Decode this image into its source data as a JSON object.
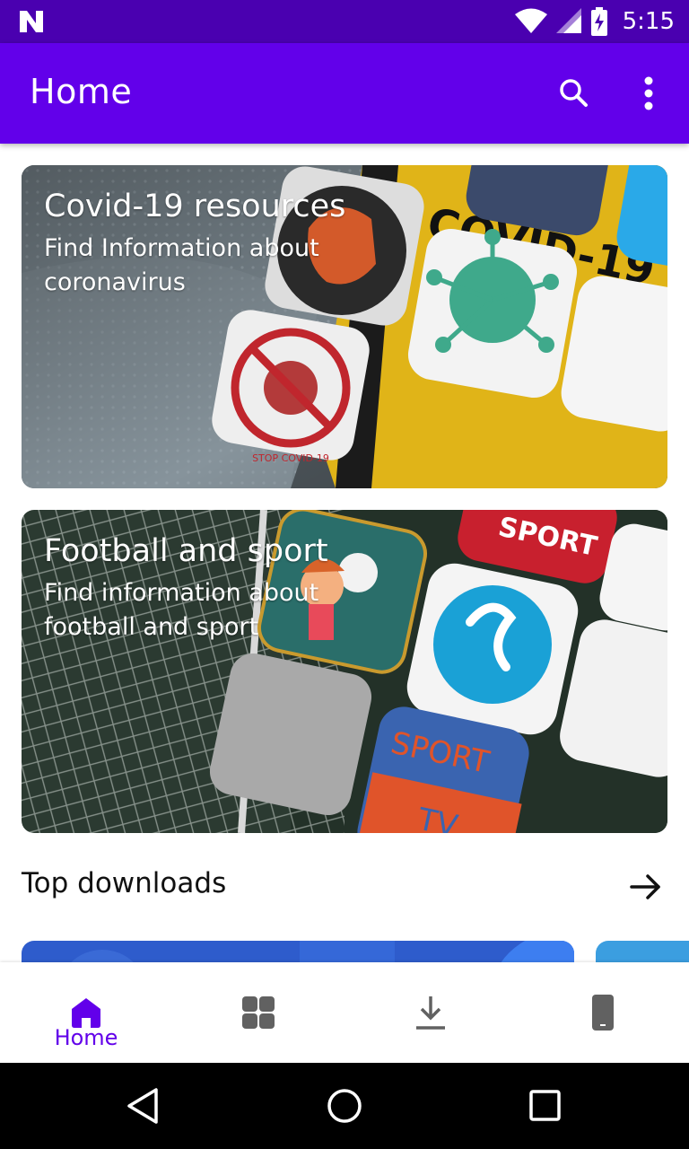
{
  "status_bar": {
    "time": "5:15"
  },
  "app_bar": {
    "title": "Home",
    "search_icon": "search-icon",
    "more_icon": "more-vert-icon"
  },
  "cards": [
    {
      "title": "Covid-19 resources",
      "subtitle": "Find Information about coronavirus"
    },
    {
      "title": "Football and sport",
      "subtitle": "Find information about football and sport"
    }
  ],
  "card_art_text": {
    "covid_banner": "COVID-19",
    "stop_badge": "STOP COVID-19",
    "sport_top": "SPORT",
    "sport_tv": "SPORT",
    "tv": "TV"
  },
  "top_downloads": {
    "title": "Top downloads",
    "arrow_icon": "arrow-forward-icon"
  },
  "bottom_nav": {
    "active": "Home",
    "items": [
      {
        "label": "Home",
        "icon": "home-icon"
      },
      {
        "label": "",
        "icon": "apps-icon"
      },
      {
        "label": "",
        "icon": "download-icon"
      },
      {
        "label": "",
        "icon": "device-icon"
      }
    ]
  },
  "colors": {
    "status_bar": "#4a00b0",
    "app_bar": "#6200ea",
    "accent": "#6200ea",
    "nav_icon": "#616161"
  }
}
